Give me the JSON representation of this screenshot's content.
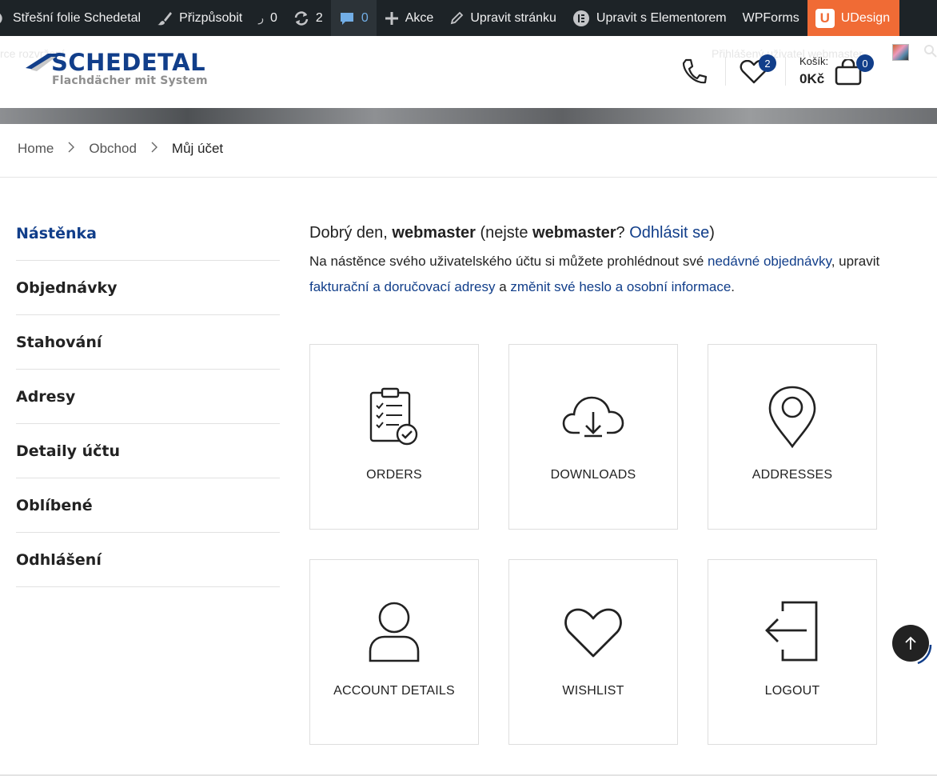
{
  "adminbar": {
    "site_name": "Střešní folie Schedetal",
    "customize": "Přizpůsobit",
    "updates_count": "0",
    "revisions_count": "2",
    "comments_count": "0",
    "new_label": "Akce",
    "edit_page": "Upravit stránku",
    "elementor": "Upravit s Elementorem",
    "wpforms": "WPForms",
    "udesign": "UDesign"
  },
  "header": {
    "ghost_left": "rce rozvržení",
    "ghost_right": "Přihlášený uživatel webmaster",
    "logo_brand": "SCHEDETAL",
    "logo_sub": "Flachdächer mit System",
    "wishlist_count": "2",
    "cart_label": "Košík:",
    "cart_total": "0Kč",
    "cart_count": "0"
  },
  "breadcrumb": {
    "home": "Home",
    "shop": "Obchod",
    "current": "Můj účet"
  },
  "sidebar": {
    "items": [
      {
        "label": "Nástěnka"
      },
      {
        "label": "Objednávky"
      },
      {
        "label": "Stahování"
      },
      {
        "label": "Adresy"
      },
      {
        "label": "Detaily účtu"
      },
      {
        "label": "Oblíbené"
      },
      {
        "label": "Odhlášení"
      }
    ]
  },
  "content": {
    "greet_prefix": "Dobrý den, ",
    "user": "webmaster",
    "greet_mid": " (nejste ",
    "greet_q": "?",
    "logout_link": "Odhlásit se",
    "greet_end": ")",
    "intro_1": "Na nástěnce svého uživatelského účtu si můžete prohlédnout své ",
    "intro_link_orders": "nedávné objednávky",
    "intro_2": ", upravit ",
    "intro_link_addresses": "fakturační a doručovací adresy",
    "intro_3": " a ",
    "intro_link_account": "změnit své heslo a osobní informace",
    "intro_4": "."
  },
  "tiles": [
    {
      "label": "ORDERS",
      "icon": "clipboard-check-icon"
    },
    {
      "label": "DOWNLOADS",
      "icon": "cloud-download-icon"
    },
    {
      "label": "ADDRESSES",
      "icon": "map-pin-icon"
    },
    {
      "label": "ACCOUNT DETAILS",
      "icon": "user-icon"
    },
    {
      "label": "WISHLIST",
      "icon": "heart-icon"
    },
    {
      "label": "LOGOUT",
      "icon": "logout-icon"
    }
  ],
  "colors": {
    "accent": "#113e8a",
    "adminbar_bg": "#1d2327",
    "udesign_bg": "#f06b35"
  }
}
